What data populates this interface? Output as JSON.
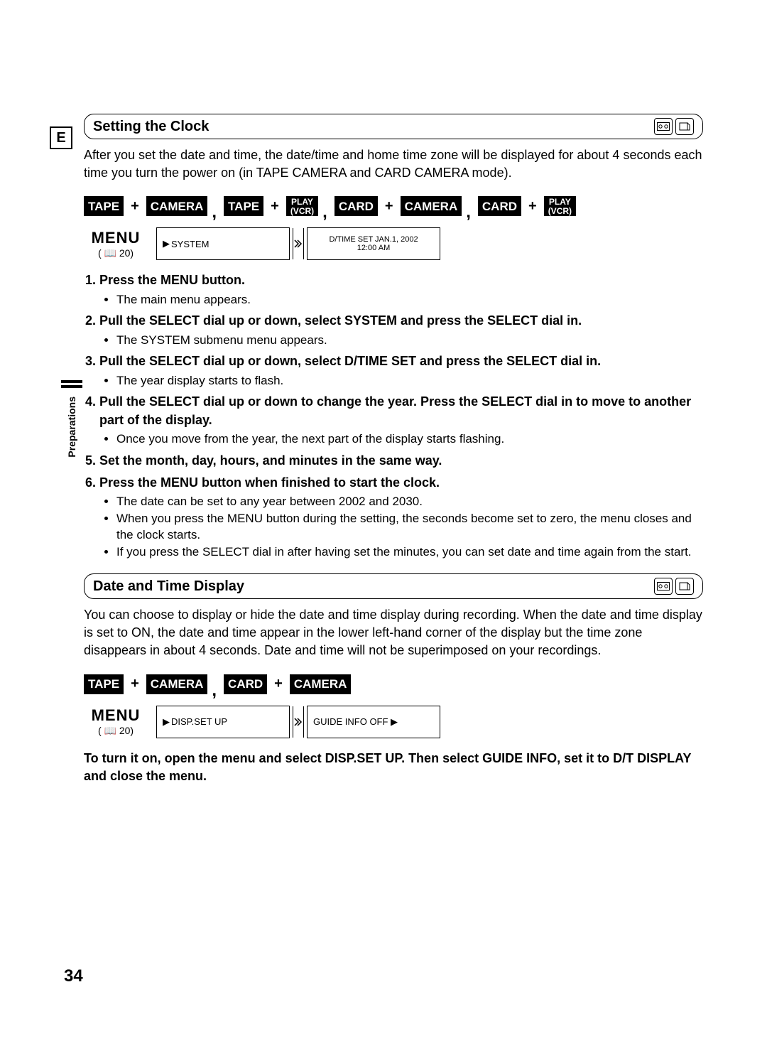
{
  "lang_code": "E",
  "section1": {
    "title": "Setting the Clock",
    "intro": "After you set the date and time, the date/time and home time zone will be displayed for about 4 seconds each time you turn the power on (in TAPE CAMERA and CARD CAMERA mode).",
    "modes": {
      "tape": "TAPE",
      "camera": "CAMERA",
      "play_top": "PLAY",
      "play_sub": "(VCR)",
      "card": "CARD"
    },
    "menu_label": "MENU",
    "menu_page": "20",
    "screens": {
      "system_label": "SYSTEM",
      "dtime_line1": "D/TIME SET   JAN.1, 2002",
      "dtime_line2": "12:00 AM"
    },
    "steps": [
      {
        "title": "Press the MENU button.",
        "bullets": [
          "The main menu appears."
        ]
      },
      {
        "title": "Pull the SELECT dial up or down, select SYSTEM and press the SELECT dial in.",
        "bullets": [
          "The SYSTEM submenu menu appears."
        ]
      },
      {
        "title": "Pull the SELECT dial up or down, select D/TIME SET and press the SELECT dial in.",
        "bullets": [
          "The year display starts to flash."
        ]
      },
      {
        "title": "Pull the SELECT dial up or down to change the year. Press the SELECT dial in to move to another part of the display.",
        "bullets": [
          "Once you move from the year, the next part of the display starts flashing."
        ]
      },
      {
        "title": "Set the month, day, hours, and minutes in the same way.",
        "bullets": []
      },
      {
        "title": "Press the MENU button when finished to start the clock.",
        "bullets": [
          "The date can be set to any year between 2002 and 2030.",
          "When you press the MENU button during the setting, the seconds become set to zero, the menu closes and the clock starts.",
          "If you press the SELECT dial in after having set the minutes, you can set date and time again from the start."
        ]
      }
    ]
  },
  "section2": {
    "title": "Date and Time Display",
    "intro": "You can choose to display or hide the date and time display during recording. When the date and time display is set to ON, the date and time appear in the lower left-hand corner of the display but the time zone disappears in about 4 seconds. Date and time will not be superimposed on your recordings.",
    "modes": {
      "tape": "TAPE",
      "camera": "CAMERA",
      "card": "CARD"
    },
    "menu_label": "MENU",
    "menu_page": "20",
    "screens": {
      "disp_label": "DISP.SET UP",
      "guide_label": "GUIDE INFO   OFF  ▶"
    },
    "final": "To turn it on, open the menu and select DISP.SET UP. Then select GUIDE INFO, set it to D/T DISPLAY and close the menu."
  },
  "side_label": "Preparations",
  "page_number": "34"
}
